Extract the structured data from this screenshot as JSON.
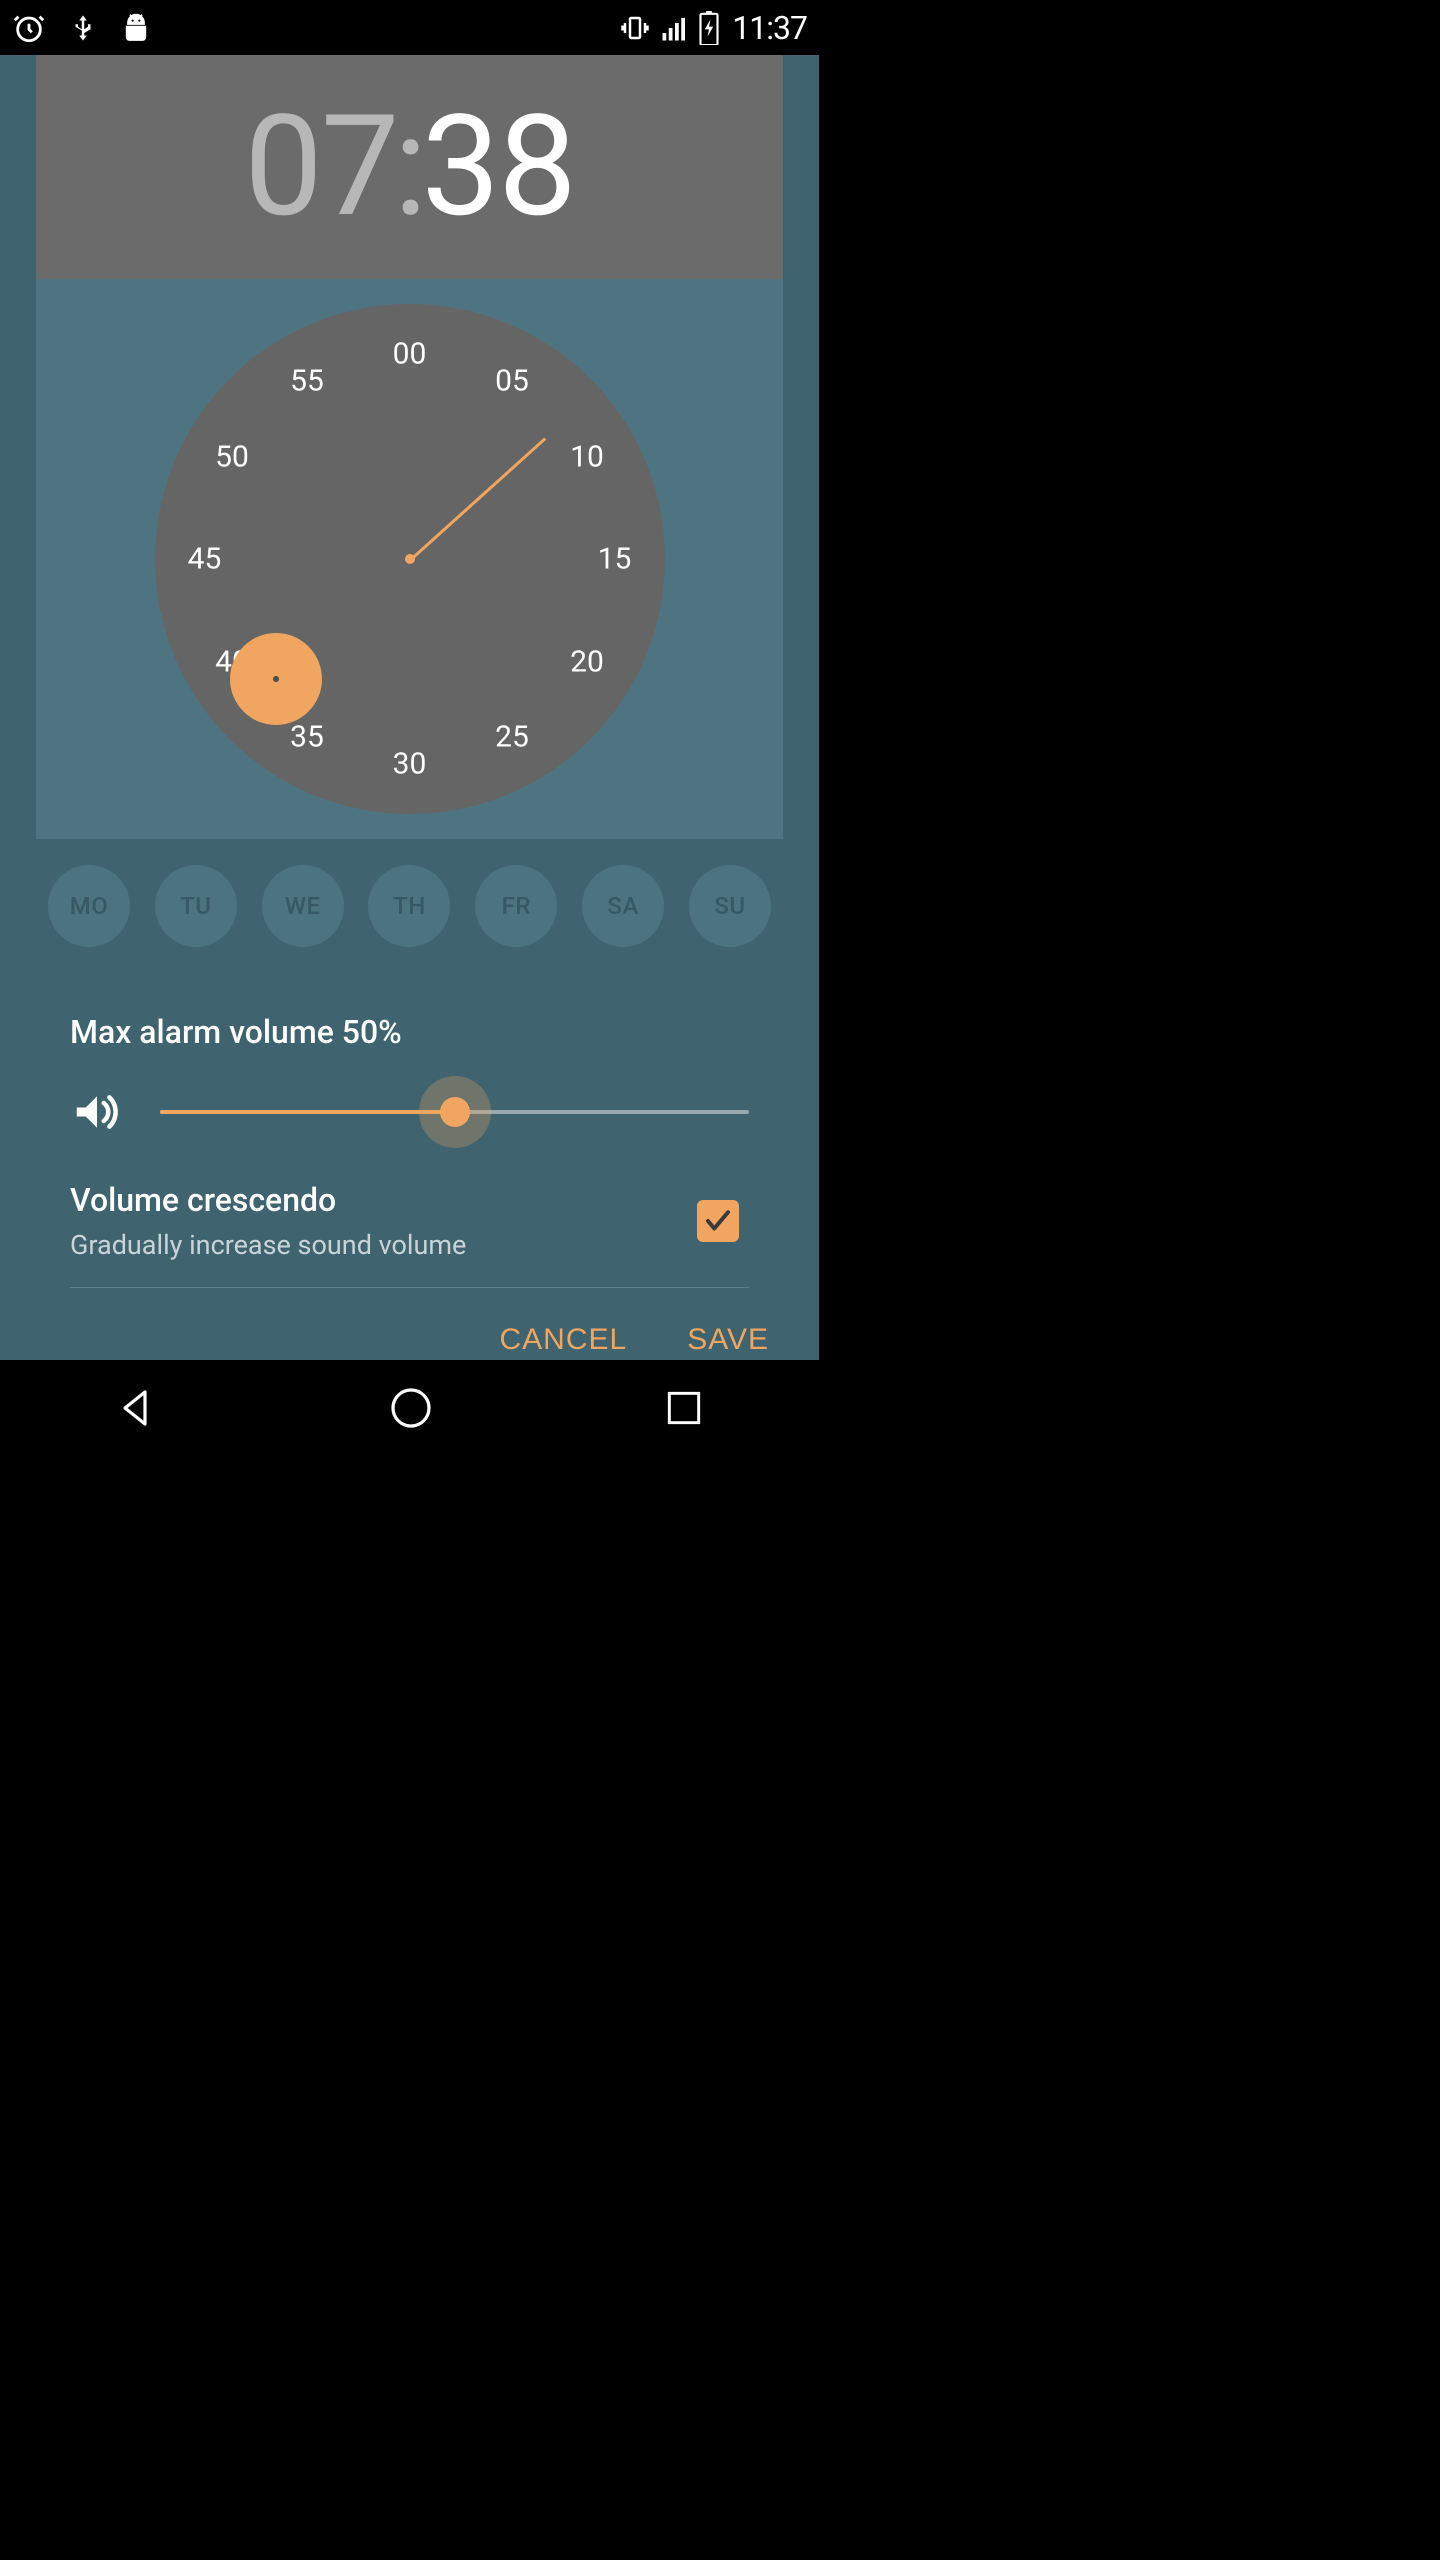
{
  "status": {
    "time": "11:37"
  },
  "time": {
    "hour": "07",
    "colon": ":",
    "minute": "38"
  },
  "dial": {
    "ticks": [
      "00",
      "05",
      "10",
      "15",
      "20",
      "25",
      "30",
      "35",
      "40",
      "45",
      "50",
      "55"
    ],
    "selected_minute": 38
  },
  "days": {
    "items": [
      "MO",
      "TU",
      "WE",
      "TH",
      "FR",
      "SA",
      "SU"
    ]
  },
  "volume": {
    "title": "Max alarm volume 50%",
    "percent": 50
  },
  "crescendo": {
    "title": "Volume crescendo",
    "subtitle": "Gradually increase sound volume",
    "checked": true
  },
  "actions": {
    "cancel": "CANCEL",
    "save": "SAVE"
  },
  "colors": {
    "accent": "#f0a661",
    "bg": "#3f636f",
    "panel": "#4f7481",
    "grey": "#6b6b6b",
    "dial": "#656565"
  }
}
